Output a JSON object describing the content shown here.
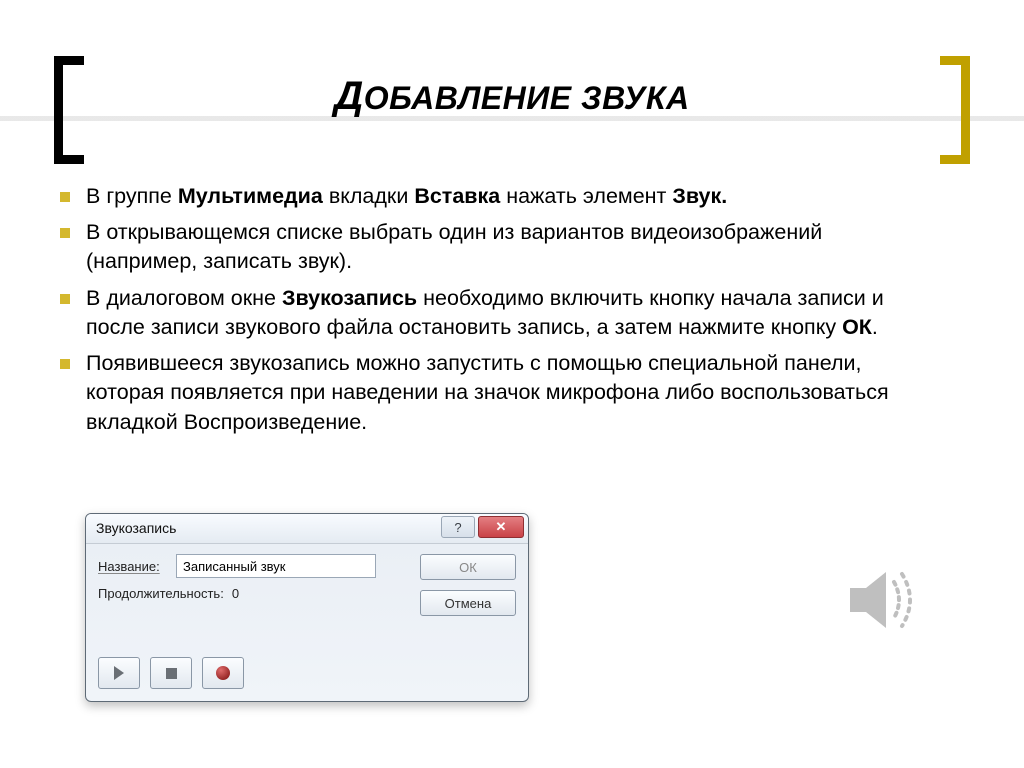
{
  "title": {
    "cap": "Д",
    "rest": "ОБАВЛЕНИЕ ЗВУКА"
  },
  "bullets": [
    {
      "parts": [
        "В группе ",
        {
          "b": "Мультимедиа"
        },
        " вкладки ",
        {
          "b": "Вставка"
        },
        " нажать элемент ",
        {
          "b": "Звук."
        }
      ]
    },
    {
      "parts": [
        "В открывающемся списке выбрать один из вариантов видеоизображений (например, записать звук)."
      ]
    },
    {
      "parts": [
        "В диалоговом окне ",
        {
          "b": "Звукозапись"
        },
        " необходимо включить кнопку начала записи и после записи звукового файла остановить запись, а затем нажмите кнопку ",
        {
          "b": "ОК"
        },
        "."
      ]
    },
    {
      "parts": [
        "Появившееся звукозапись можно запустить с помощью специальной панели, которая появляется при наведении на значок микрофона либо воспользоваться вкладкой Воспроизведение."
      ]
    }
  ],
  "dialog": {
    "title": "Звукозапись",
    "help_tooltip": "?",
    "close_tooltip": "✕",
    "name_label": "Название:",
    "name_value": "Записанный звук",
    "duration_label": "Продолжительность:",
    "duration_value": "0",
    "ok_label": "ОК",
    "cancel_label": "Отмена"
  }
}
